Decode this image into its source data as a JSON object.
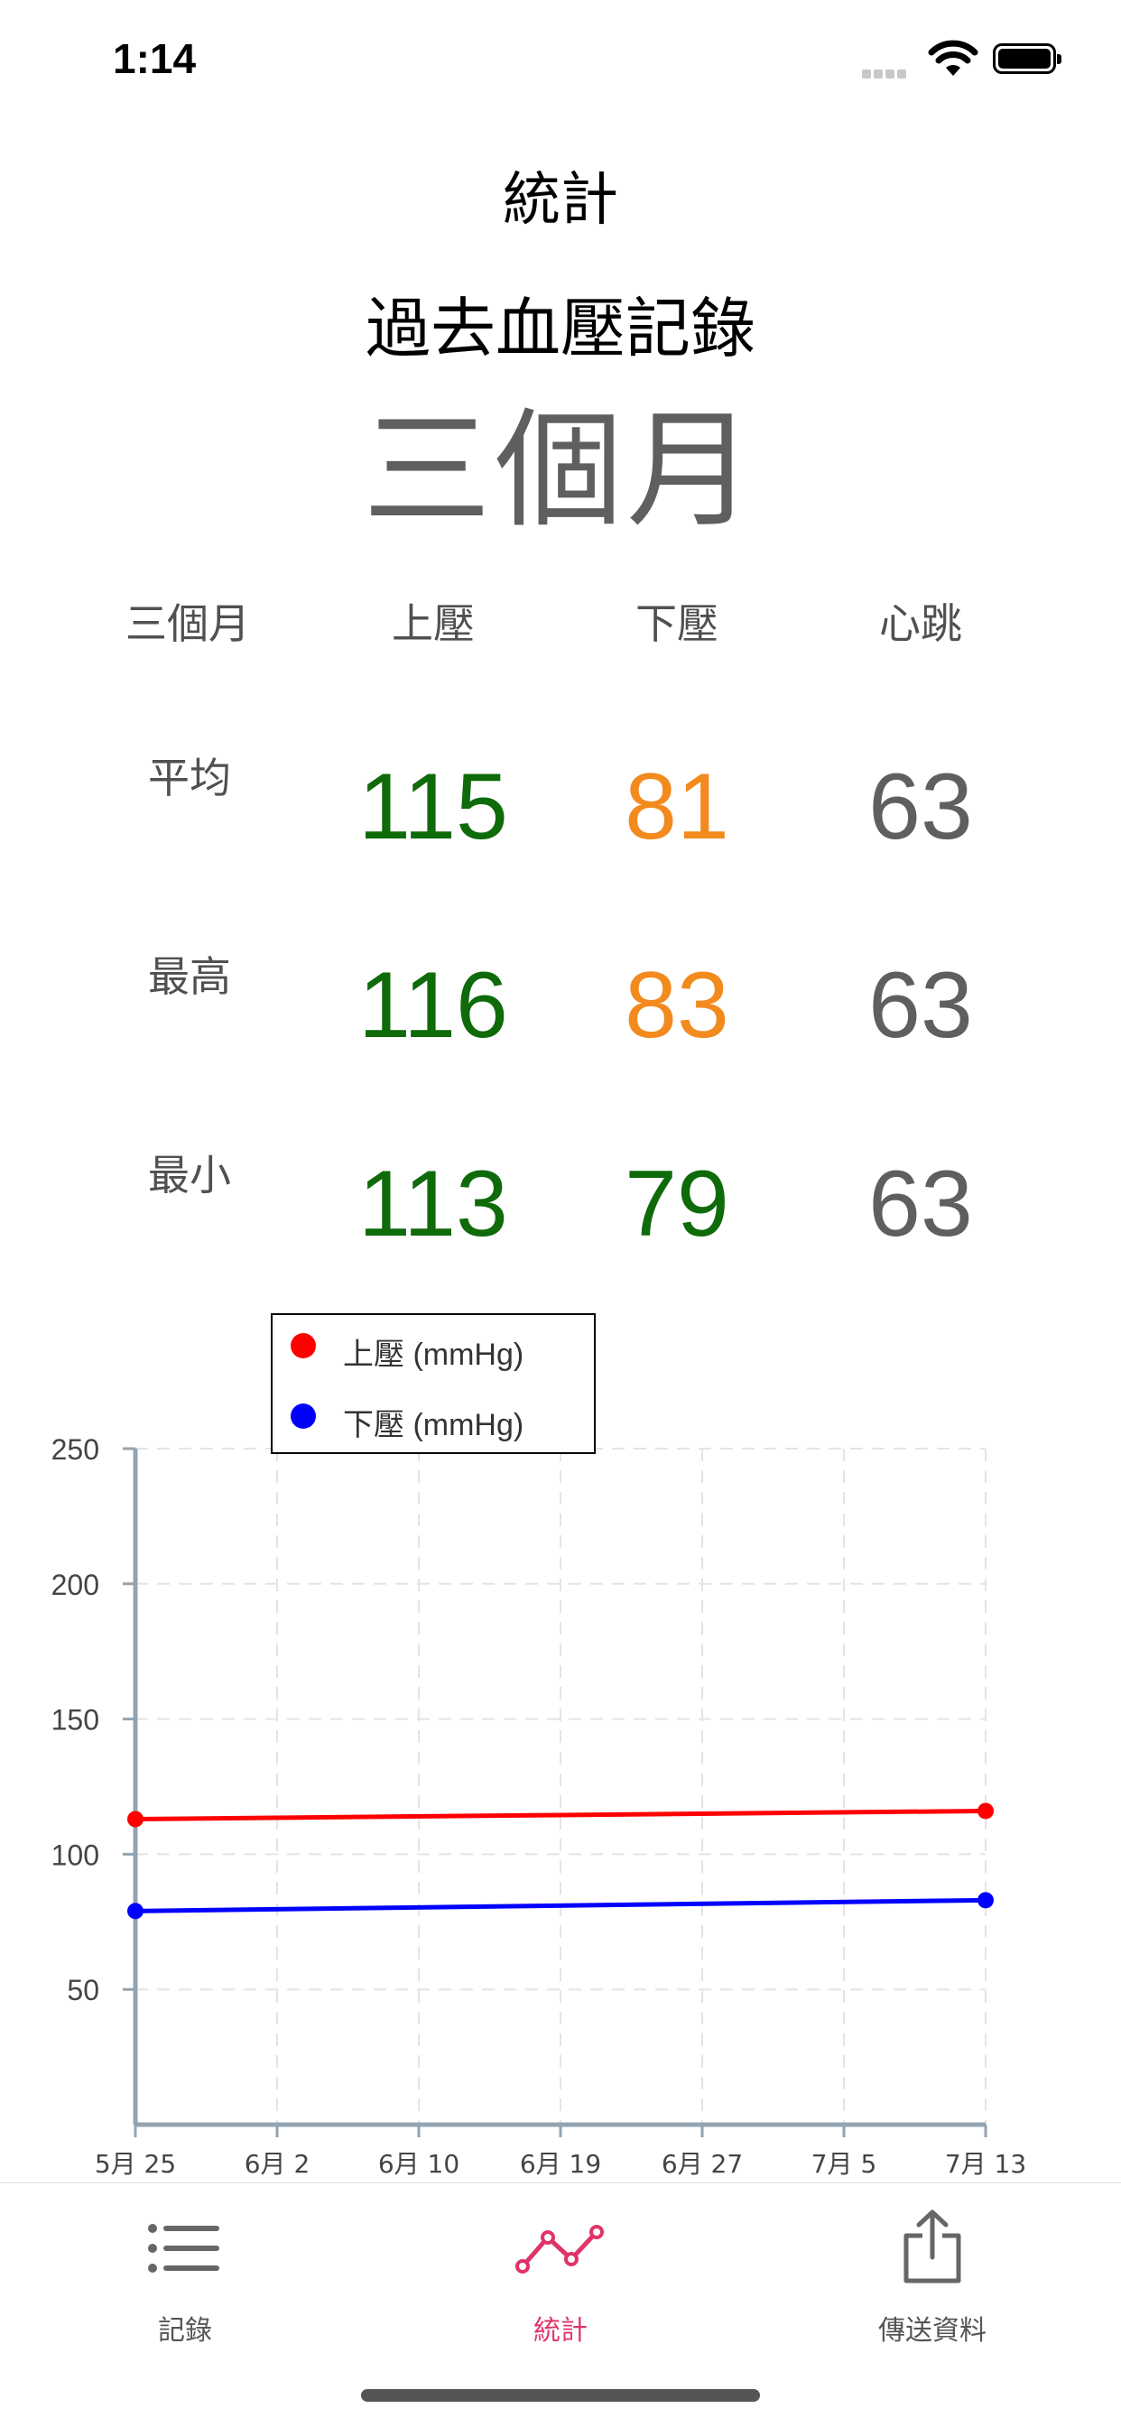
{
  "status_bar": {
    "time": "1:14"
  },
  "nav": {
    "title": "統計"
  },
  "header": {
    "subtitle": "過去血壓記錄",
    "period": "三個月"
  },
  "table": {
    "columns": [
      "三個月",
      "上壓",
      "下壓",
      "心跳"
    ],
    "rows": [
      {
        "label": "平均",
        "systolic": "115",
        "diastolic": "81",
        "pulse": "63"
      },
      {
        "label": "最高",
        "systolic": "116",
        "diastolic": "83",
        "pulse": "63"
      },
      {
        "label": "最小",
        "systolic": "113",
        "diastolic": "79",
        "pulse": "63"
      }
    ]
  },
  "colors": {
    "green": "#0f6a0a",
    "orange": "#f28a1e",
    "grey": "#5f5f5f",
    "accent": "#e03468"
  },
  "chart_data": {
    "type": "line",
    "x": [
      "5月 25",
      "7月 13"
    ],
    "x_tick_labels": [
      "5月 25",
      "6月 2",
      "6月 10",
      "6月 19",
      "6月 27",
      "7月 5",
      "7月 13"
    ],
    "y_tick_labels": [
      "250",
      "200",
      "150",
      "100",
      "50"
    ],
    "ylim": [
      0,
      250
    ],
    "grid": true,
    "legend_placement": "top-left",
    "series": [
      {
        "name": "上壓 (mmHg)",
        "color": "#ff0000",
        "values": [
          113,
          116
        ]
      },
      {
        "name": "下壓 (mmHg)",
        "color": "#0000ff",
        "values": [
          79,
          83
        ]
      }
    ]
  },
  "tabbar": {
    "items": [
      {
        "label": "記錄",
        "icon": "list-icon"
      },
      {
        "label": "統計",
        "icon": "chart-line-icon",
        "active": true
      },
      {
        "label": "傳送資料",
        "icon": "share-icon"
      }
    ]
  }
}
